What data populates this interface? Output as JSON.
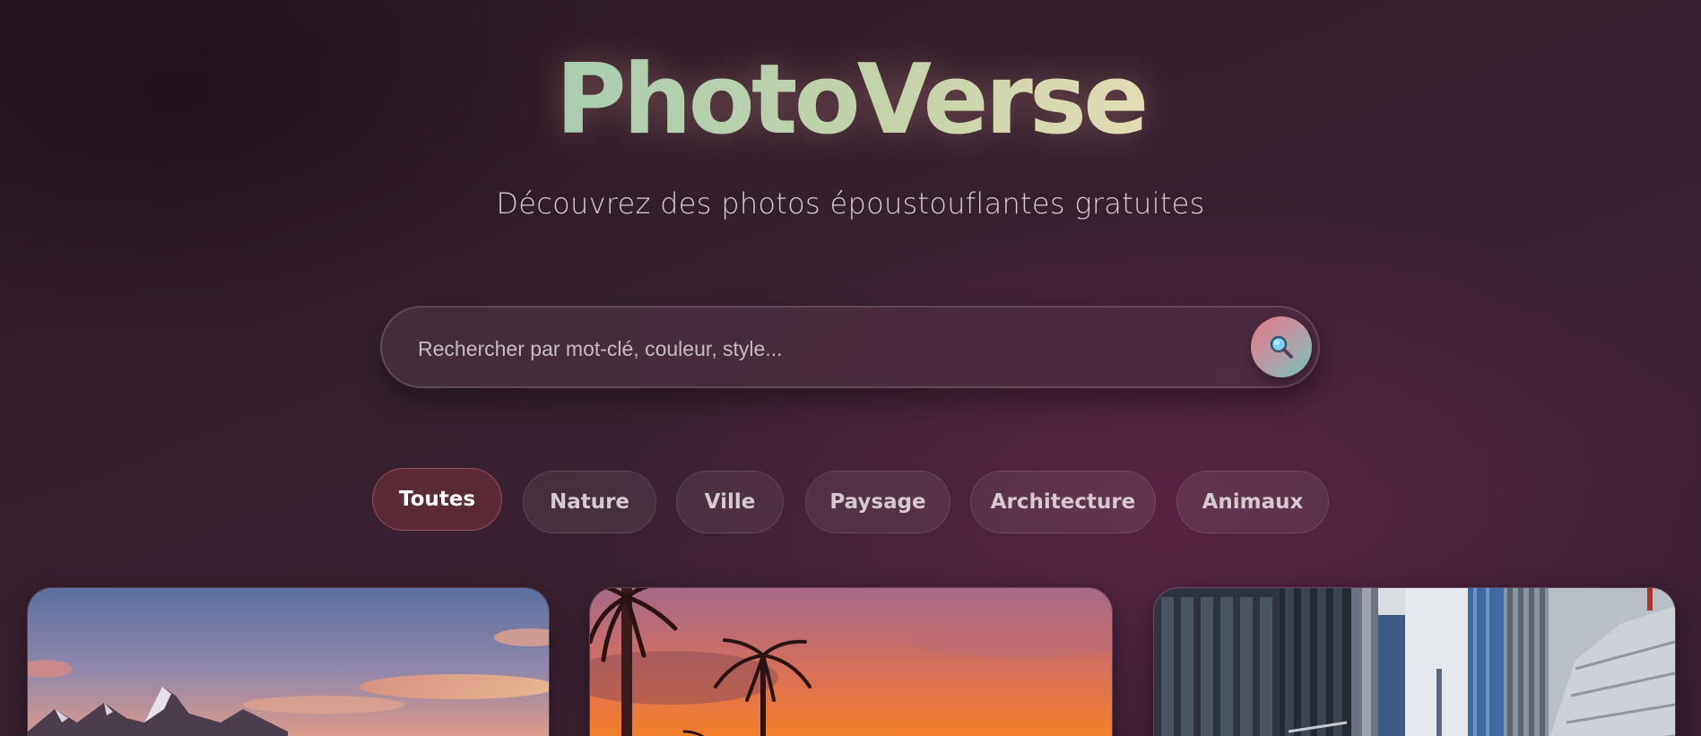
{
  "header": {
    "logo": "PhotoVerse",
    "tagline": "Découvrez des photos époustouflantes gratuites"
  },
  "search": {
    "placeholder": "Rechercher par mot-clé, couleur, style...",
    "value": "",
    "button_icon": "search-icon"
  },
  "filters": [
    {
      "label": "Toutes",
      "active": true
    },
    {
      "label": "Nature",
      "active": false
    },
    {
      "label": "Ville",
      "active": false
    },
    {
      "label": "Paysage",
      "active": false
    },
    {
      "label": "Architecture",
      "active": false
    },
    {
      "label": "Animaux",
      "active": false
    }
  ],
  "gallery": [
    {
      "subject": "mountain-sunset"
    },
    {
      "subject": "palm-trees-sunset"
    },
    {
      "subject": "city-skyscrapers"
    }
  ],
  "colors": {
    "background": "#33202c",
    "accent_active_chip": "#5a2a36",
    "logo_gradient_start": "#a9cdb0",
    "logo_gradient_end": "#e2dcb4"
  }
}
